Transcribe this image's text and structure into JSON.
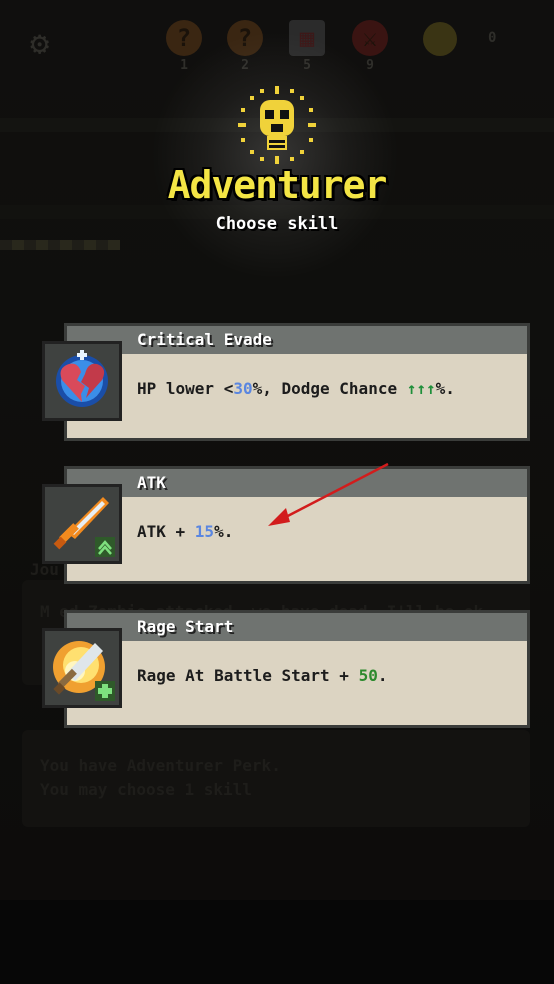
{
  "hud": {
    "items": [
      {
        "icon": "question-icon",
        "glyph": "?",
        "count": "1"
      },
      {
        "icon": "question-icon",
        "glyph": "?",
        "count": "2"
      },
      {
        "icon": "card-icon",
        "glyph": "▦",
        "count": "5"
      },
      {
        "icon": "sword-icon",
        "glyph": "⚔",
        "count": "9"
      }
    ],
    "coins": "0"
  },
  "header": {
    "title": "Adventurer",
    "subtitle": "Choose skill"
  },
  "skills": [
    {
      "name": "Critical Evade",
      "icon": "broken-heart-icon",
      "desc_prefix": "HP lower <",
      "desc_value": "30",
      "desc_middle": "%, Dodge Chance ",
      "desc_arrows": "↑↑↑",
      "desc_suffix": "%."
    },
    {
      "name": "ATK",
      "icon": "sword-upgrade-icon",
      "desc_prefix": "ATK + ",
      "desc_value": "15",
      "desc_suffix": "%."
    },
    {
      "name": "Rage Start",
      "icon": "flaming-sword-icon",
      "desc_prefix": "Rage At Battle Start + ",
      "desc_value": "50",
      "desc_suffix": "."
    }
  ],
  "background": {
    "journal_label": "Jou",
    "journal_text": "M   ed Zombie attacked, we have dead, I'll be ok",
    "perk_message_line1": "You have Adventurer Perk.",
    "perk_message_line2": "You may choose 1 skill"
  }
}
